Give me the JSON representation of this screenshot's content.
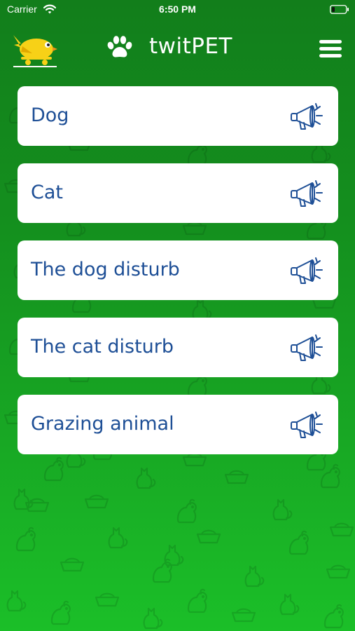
{
  "status_bar": {
    "carrier": "Carrier",
    "time": "6:50 PM",
    "icons": [
      "wifi-icon",
      "battery-icon"
    ]
  },
  "header": {
    "title": "twitPET",
    "logo": "yellow-bird-cart-logo",
    "title_icon": "paw-icon",
    "menu_icon": "hamburger-menu-icon"
  },
  "categories": [
    {
      "label": "Dog",
      "icon": "megaphone-icon"
    },
    {
      "label": "Cat",
      "icon": "megaphone-icon"
    },
    {
      "label": "The dog disturb",
      "icon": "megaphone-icon"
    },
    {
      "label": "The cat disturb",
      "icon": "megaphone-icon"
    },
    {
      "label": "Grazing animal",
      "icon": "megaphone-icon"
    }
  ],
  "colors": {
    "background_top": "#127e1b",
    "background_bottom": "#1bbf28",
    "card": "#ffffff",
    "label_text": "#1e4f96",
    "logo_yellow": "#f7d117"
  }
}
